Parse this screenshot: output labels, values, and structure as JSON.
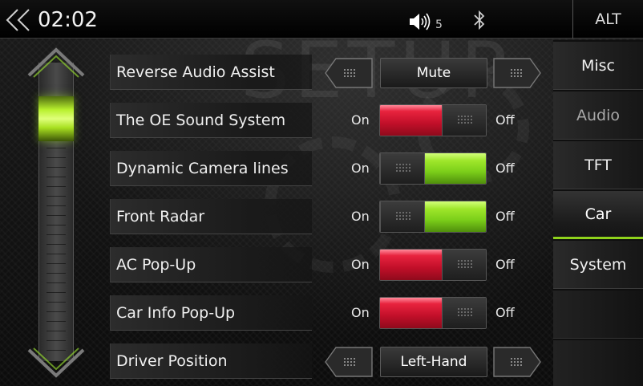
{
  "status_bar": {
    "time": "02:02",
    "volume_level": "5",
    "alt_label": "ALT"
  },
  "watermark": "SETUP",
  "settings": [
    {
      "label": "Reverse Audio Assist",
      "type": "selector",
      "value": "Mute"
    },
    {
      "label": "The OE Sound System",
      "type": "toggle",
      "on_label": "On",
      "off_label": "Off",
      "state": "off",
      "color": "#d0142e"
    },
    {
      "label": "Dynamic Camera lines",
      "type": "toggle",
      "on_label": "On",
      "off_label": "Off",
      "state": "on",
      "color": "#8ee026"
    },
    {
      "label": "Front Radar",
      "type": "toggle",
      "on_label": "On",
      "off_label": "Off",
      "state": "on",
      "color": "#8ee026"
    },
    {
      "label": "AC Pop-Up",
      "type": "toggle",
      "on_label": "On",
      "off_label": "Off",
      "state": "off",
      "color": "#d0142e"
    },
    {
      "label": "Car Info Pop-Up",
      "type": "toggle",
      "on_label": "On",
      "off_label": "Off",
      "state": "off",
      "color": "#d0142e"
    },
    {
      "label": "Driver Position",
      "type": "selector",
      "value": "Left-Hand"
    }
  ],
  "tabs": [
    {
      "label": "Misc",
      "active": false,
      "dim": false
    },
    {
      "label": "Audio",
      "active": false,
      "dim": true
    },
    {
      "label": "TFT",
      "active": false,
      "dim": false
    },
    {
      "label": "Car",
      "active": true,
      "dim": false
    },
    {
      "label": "System",
      "active": false,
      "dim": false
    }
  ],
  "colors": {
    "accent_green": "#8ee026",
    "toggle_red": "#d0142e"
  },
  "icons": {
    "back": "double-chevron-left-icon",
    "volume": "speaker-icon",
    "bluetooth": "bluetooth-icon"
  }
}
